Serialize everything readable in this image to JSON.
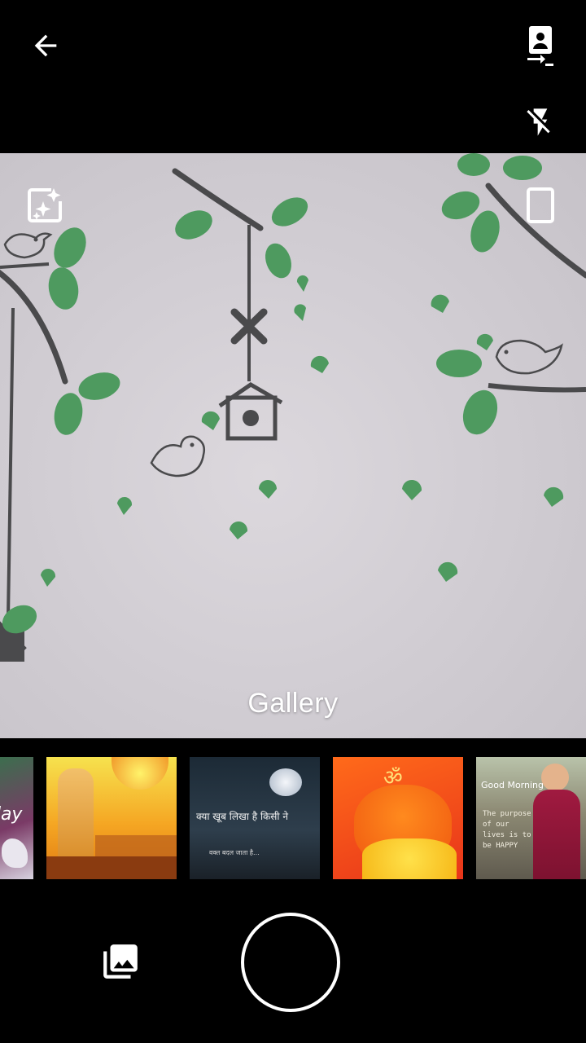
{
  "viewfinder": {
    "label": "Gallery"
  },
  "thumbnails": [
    {
      "name": "thumb-1",
      "caption": "...day"
    },
    {
      "name": "thumb-2",
      "caption": ""
    },
    {
      "name": "thumb-3",
      "caption": "क्या खूब लिखा है किसी ने",
      "subcaption": "वक्त बदल जाता है..."
    },
    {
      "name": "thumb-4",
      "caption": "ॐ"
    },
    {
      "name": "thumb-5",
      "caption": "Good Morning",
      "subcaption": "The purpose of our lives is to be HAPPY"
    }
  ],
  "colors": {
    "background": "#000000",
    "icon": "#ffffff",
    "leaf": "#4e9a5f",
    "line": "#4a4a4c"
  },
  "icons": {
    "back": "arrow-left-icon",
    "switch_camera": "switch-camera-icon",
    "flash": "flash-off-icon",
    "enhance": "auto-enhance-icon",
    "aspect": "aspect-ratio-icon",
    "gallery": "photo-library-icon"
  }
}
